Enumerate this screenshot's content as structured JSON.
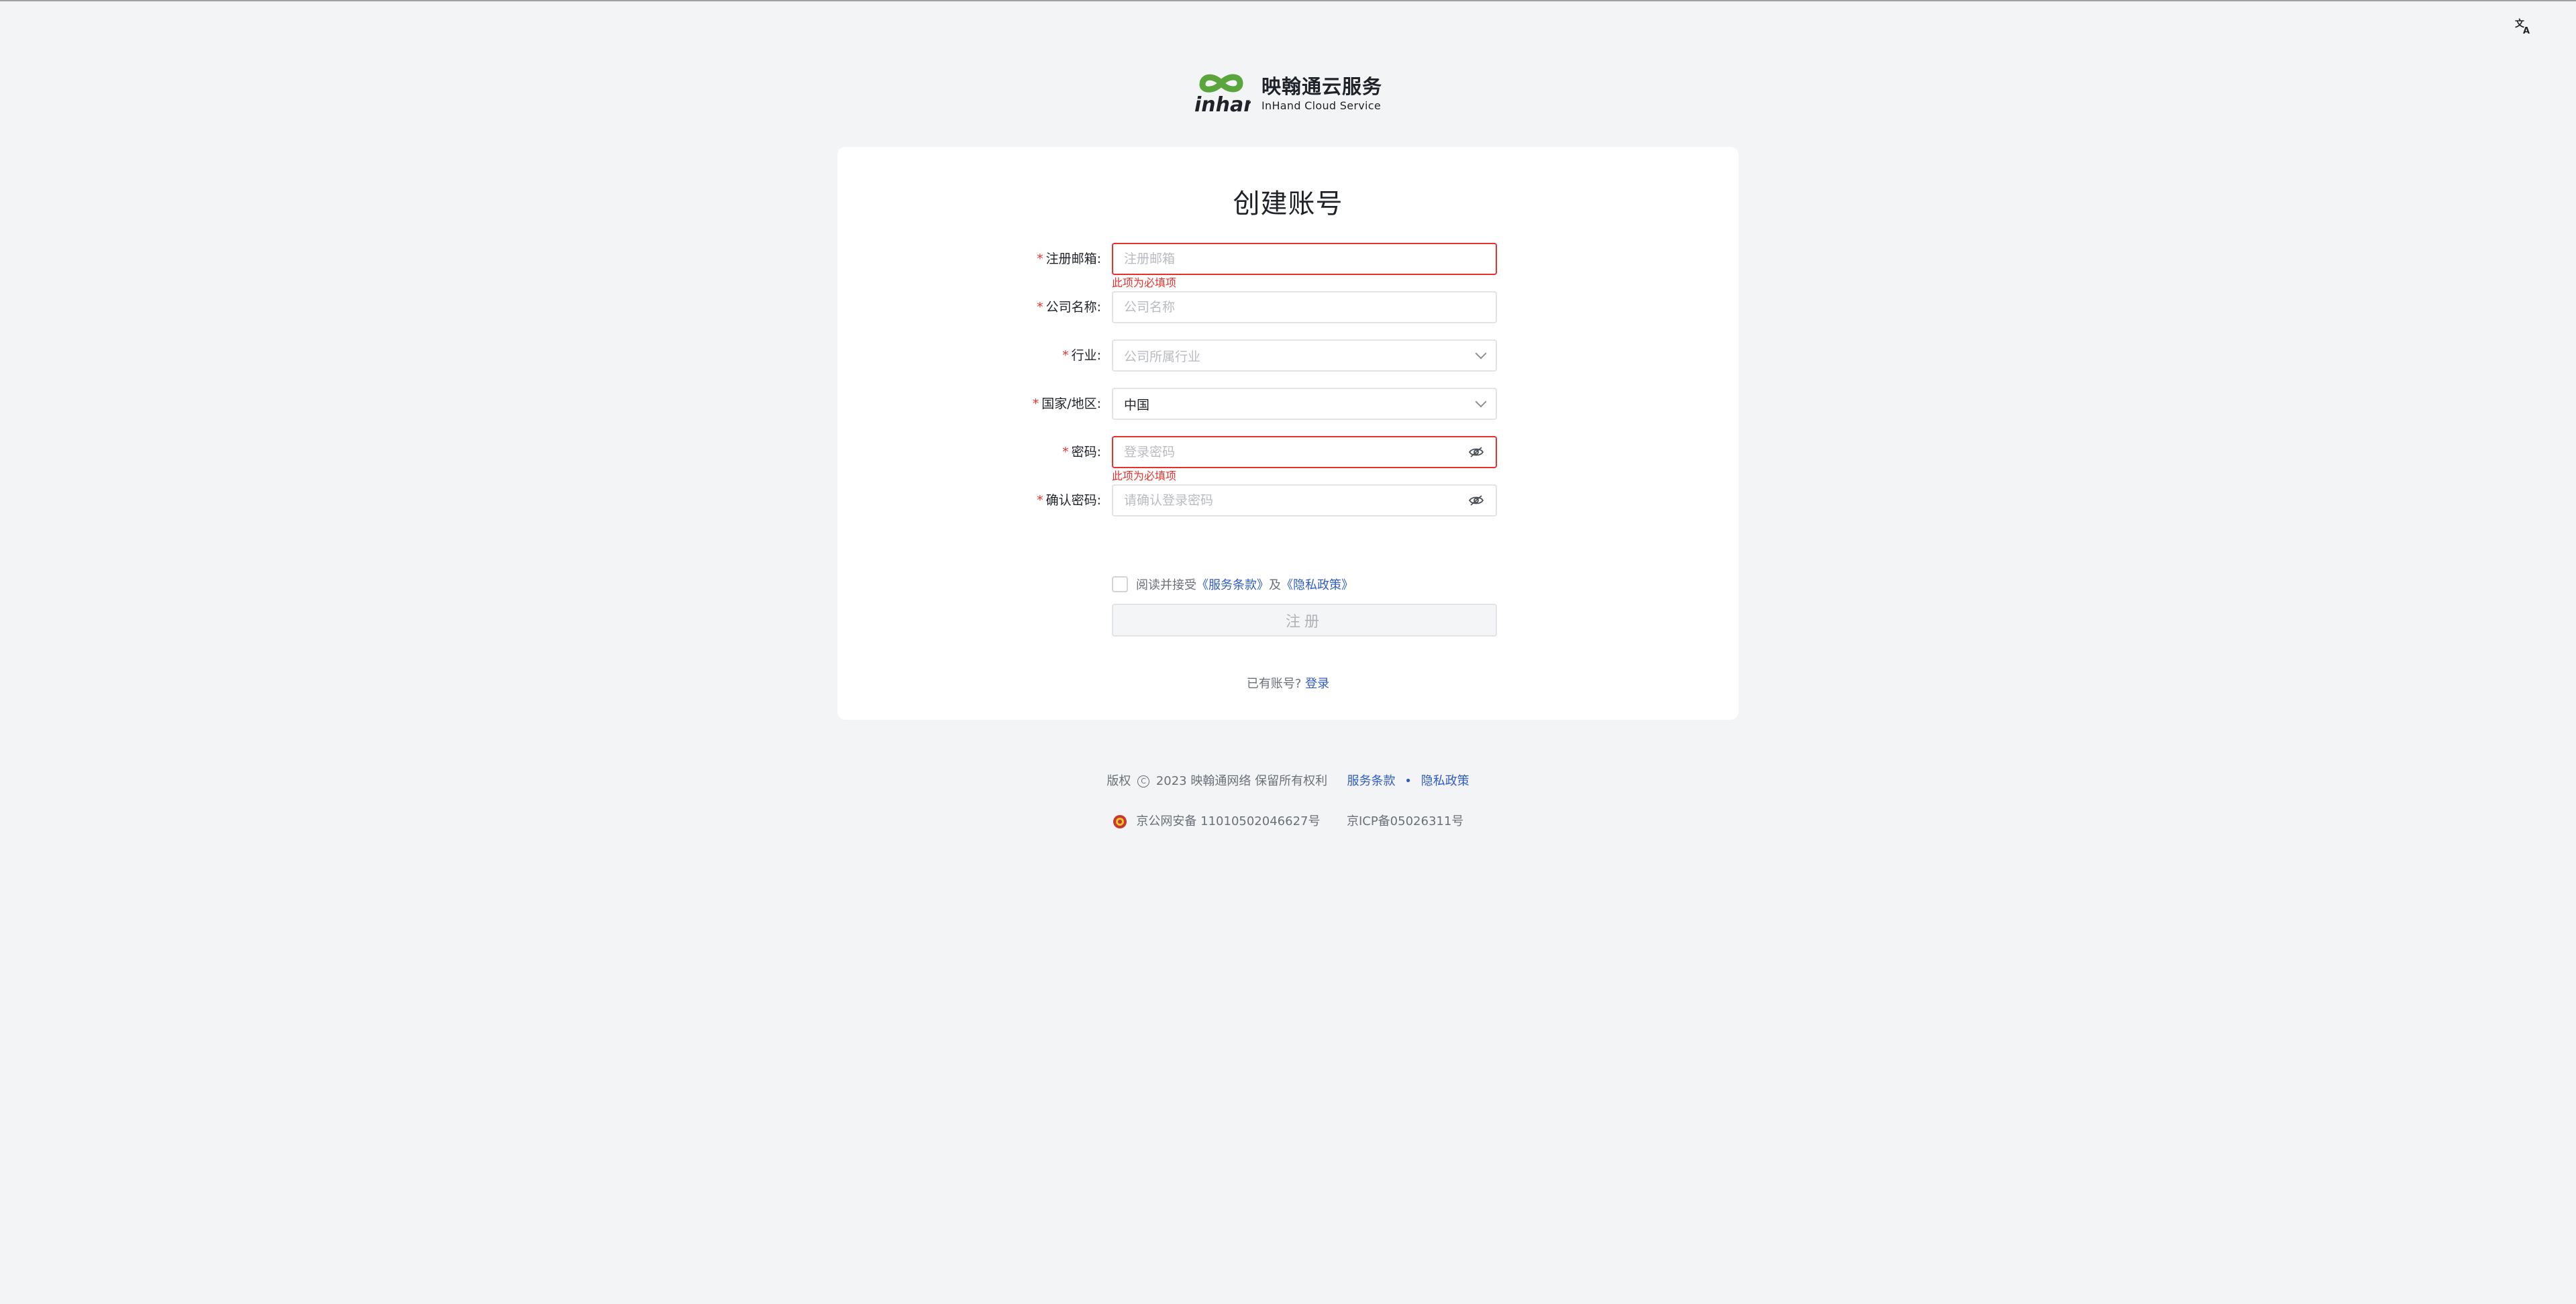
{
  "language_icon": "translate-icon",
  "logo": {
    "icon": "inhand-logo-mark",
    "brand_text": "inhand",
    "name_cn": "映翰通云服务",
    "name_en": "InHand Cloud Service"
  },
  "form": {
    "title": "创建账号",
    "email": {
      "label": "注册邮箱:",
      "placeholder": "注册邮箱",
      "error": "此项为必填项"
    },
    "company": {
      "label": "公司名称:",
      "placeholder": "公司名称"
    },
    "industry": {
      "label": "行业:",
      "placeholder": "公司所属行业"
    },
    "country": {
      "label": "国家/地区:",
      "value": "中国"
    },
    "password": {
      "label": "密码:",
      "placeholder": "登录密码",
      "error": "此项为必填项"
    },
    "confirm_password": {
      "label": "确认密码:",
      "placeholder": "请确认登录密码"
    },
    "agree": {
      "prefix": "阅读并接受",
      "terms": "《服务条款》",
      "and": "及",
      "privacy": "《隐私政策》"
    },
    "submit_label": "注册",
    "has_account": "已有账号?",
    "login_link": "登录"
  },
  "footer": {
    "copyright_prefix": "版权",
    "copyright_text": "2023 映翰通网络 保留所有权利",
    "terms": "服务条款",
    "dot": "•",
    "privacy": "隐私政策",
    "police_record": "京公网安备 11010502046627号",
    "icp": "京ICP备05026311号"
  },
  "colors": {
    "accent": "#2f5cc4",
    "error": "#e5322d",
    "brand_green": "#5aa53c",
    "background": "#f3f4f6"
  }
}
